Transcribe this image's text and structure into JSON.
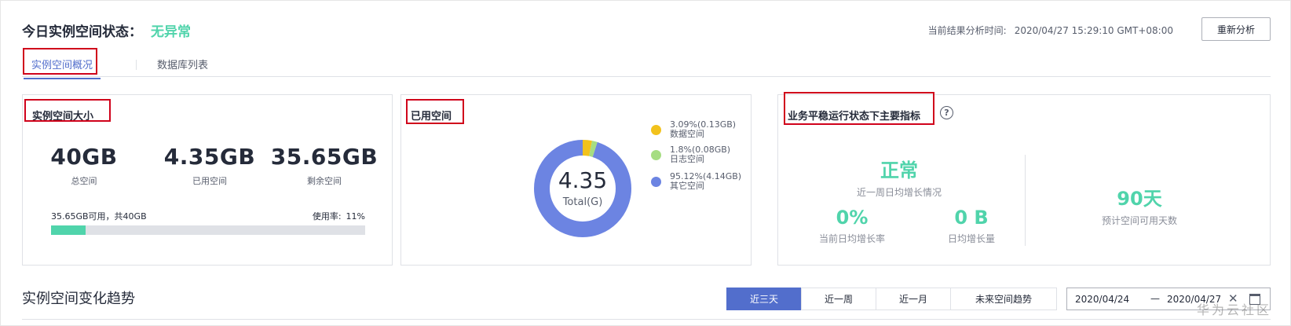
{
  "header": {
    "title": "今日实例空间状态：",
    "status": "无异常",
    "analysis_time_label": "当前结果分析时间:",
    "analysis_time_value": "2020/04/27 15:29:10 GMT+08:00",
    "reanalyze_label": "重新分析"
  },
  "tabs": [
    {
      "label": "实例空间概况",
      "active": true
    },
    {
      "label": "数据库列表",
      "active": false
    }
  ],
  "instance_size": {
    "title": "实例空间大小",
    "total": {
      "value": "40GB",
      "label": "总空间"
    },
    "used": {
      "value": "4.35GB",
      "label": "已用空间"
    },
    "remaining": {
      "value": "35.65GB",
      "label": "剩余空间"
    },
    "available_text": "35.65GB可用，共40GB",
    "usage_label": "使用率:",
    "usage_value": "11%",
    "usage_fraction": 0.11
  },
  "used_space": {
    "title": "已用空间",
    "center_value": "4.35",
    "center_label": "Total(G)",
    "legend": [
      {
        "percent": "3.09%(0.13GB)",
        "label": "数据空间",
        "color": "#f2c21c",
        "fraction": 0.0309
      },
      {
        "percent": "1.8%(0.08GB)",
        "label": "日志空间",
        "color": "#a6dd82",
        "fraction": 0.018
      },
      {
        "percent": "95.12%(4.14GB)",
        "label": "其它空间",
        "color": "#6c84e2",
        "fraction": 0.9512
      }
    ]
  },
  "key_metrics": {
    "title": "业务平稳运行状态下主要指标",
    "help_icon": "?",
    "weekly_status": {
      "value": "正常",
      "label": "近一周日均增长情况"
    },
    "daily_growth_rate": {
      "value": "0%",
      "label": "当前日均增长率"
    },
    "daily_growth_amount": {
      "value": "0 B",
      "label": "日均增长量"
    },
    "days_available": {
      "value": "90天",
      "label": "预计空间可用天数"
    }
  },
  "trend": {
    "title": "实例空间变化趋势",
    "periods": [
      {
        "label": "近三天",
        "active": true
      },
      {
        "label": "近一周",
        "active": false
      },
      {
        "label": "近一月",
        "active": false
      },
      {
        "label": "未来空间趋势",
        "active": false
      }
    ],
    "date_start": "2020/04/24",
    "date_separator": "—",
    "date_end": "2020/04/27",
    "clear_icon": "✕"
  },
  "watermark": "华为云社区",
  "colors": {
    "accent": "#526ecc",
    "ok_green": "#50d4ab",
    "highlight_red": "#d0021b"
  }
}
